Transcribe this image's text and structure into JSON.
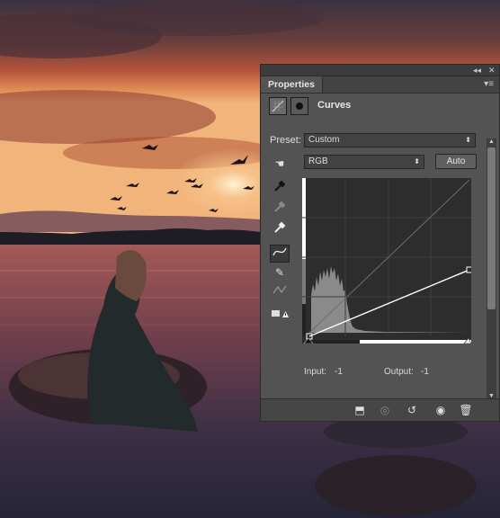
{
  "panel": {
    "collapse_icon": "double-chevron",
    "close_icon": "close",
    "tab_label": "Properties",
    "adjustment_title": "Curves",
    "preset_label": "Preset:",
    "preset_value": "Custom",
    "channel_value": "RGB",
    "auto_label": "Auto",
    "input_label": "Input:",
    "input_value": "-1",
    "output_label": "Output:",
    "output_value": "-1"
  },
  "colors": {
    "panel": "#535353",
    "curve": "#ffffff"
  }
}
